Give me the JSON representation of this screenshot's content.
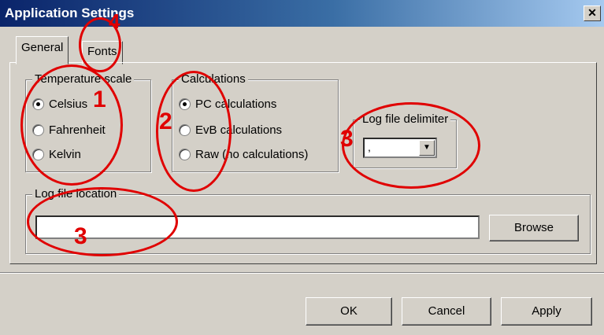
{
  "window": {
    "title": "Application Settings",
    "close_label": "✕"
  },
  "tabs": [
    {
      "label": "General"
    },
    {
      "label": "Fonts"
    }
  ],
  "temperature": {
    "legend": "Temperature scale",
    "options": [
      "Celsius",
      "Fahrenheit",
      "Kelvin"
    ],
    "selected": "Celsius"
  },
  "calculations": {
    "legend": "Calculations",
    "options": [
      "PC calculations",
      "EvB calculations",
      "Raw (no calculations)"
    ],
    "selected": "PC calculations"
  },
  "delimiter": {
    "legend": "Log file delimiter",
    "value": ","
  },
  "log_location": {
    "legend": "Log file location",
    "value": "",
    "browse_label": "Browse"
  },
  "footer": {
    "ok_label": "OK",
    "cancel_label": "Cancel",
    "apply_label": "Apply"
  },
  "annotations": {
    "n1": "1",
    "n2": "2",
    "n3a": "3",
    "n3b": "3",
    "n4": "4",
    "color": "#e00000"
  }
}
